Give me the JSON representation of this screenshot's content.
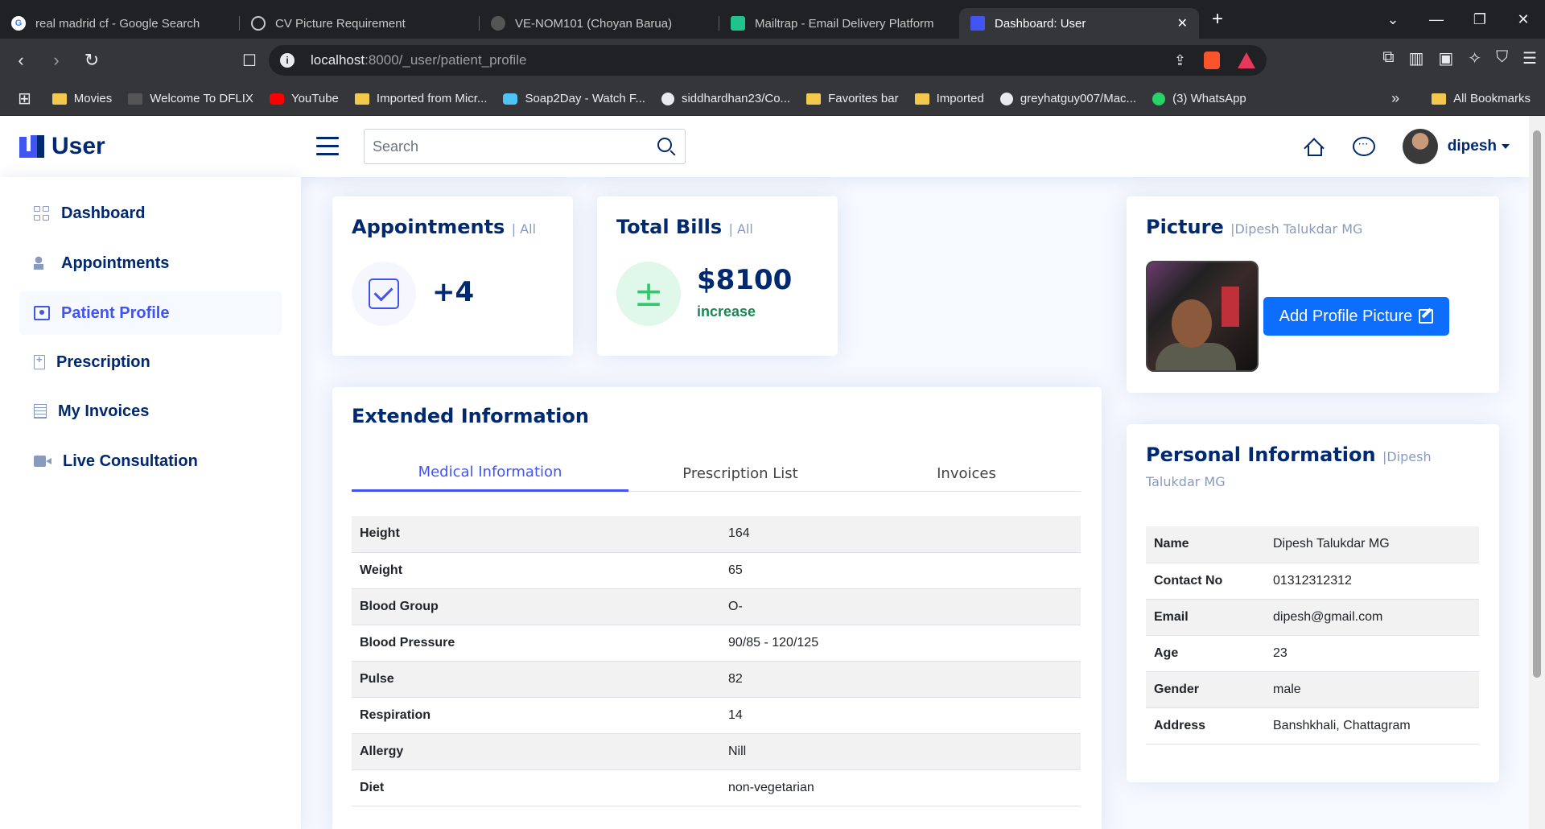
{
  "browser": {
    "tabs": [
      {
        "title": "real madrid cf - Google Search",
        "favicon": "google-icon"
      },
      {
        "title": "CV Picture Requirement",
        "favicon": "chatgpt-icon"
      },
      {
        "title": "VE-NOM101 (Choyan Barua)",
        "favicon": "github-icon"
      },
      {
        "title": "Mailtrap - Email Delivery Platform",
        "favicon": "mailtrap-icon"
      },
      {
        "title": "Dashboard: User",
        "favicon": "app-logo-icon",
        "active": true
      }
    ],
    "url_host": "localhost",
    "url_path": ":8000/_user/patient_profile",
    "bookmarks": [
      {
        "label": "Movies",
        "icon": "folder-icon"
      },
      {
        "label": "Welcome To DFLIX",
        "icon": "clapper-icon"
      },
      {
        "label": "YouTube",
        "icon": "youtube-icon"
      },
      {
        "label": "Imported from Micr...",
        "icon": "folder-icon"
      },
      {
        "label": "Soap2Day - Watch F...",
        "icon": "soap2day-icon"
      },
      {
        "label": "siddhardhan23/Co...",
        "icon": "github-icon"
      },
      {
        "label": "Favorites bar",
        "icon": "folder-icon"
      },
      {
        "label": "Imported",
        "icon": "folder-icon"
      },
      {
        "label": "greyhatguy007/Mac...",
        "icon": "github-icon"
      },
      {
        "label": "(3) WhatsApp",
        "icon": "whatsapp-icon"
      }
    ],
    "all_bookmarks": "All Bookmarks"
  },
  "header": {
    "logo_text": "User",
    "search_placeholder": "Search",
    "user_name": "dipesh"
  },
  "sidebar": {
    "items": [
      {
        "label": "Dashboard",
        "icon": "grid-icon"
      },
      {
        "label": "Appointments",
        "icon": "people-icon"
      },
      {
        "label": "Patient Profile",
        "icon": "person-card-icon",
        "active": true
      },
      {
        "label": "Prescription",
        "icon": "file-medical-icon"
      },
      {
        "label": "My Invoices",
        "icon": "receipt-icon"
      },
      {
        "label": "Live Consultation",
        "icon": "video-camera-icon"
      }
    ]
  },
  "appointments_card": {
    "title": "Appointments",
    "filter": "| All",
    "value": "+4"
  },
  "bills_card": {
    "title": "Total Bills",
    "filter": "| All",
    "value": "$8100",
    "trend": "increase"
  },
  "extended": {
    "title": "Extended Information",
    "tabs": [
      "Medical Information",
      "Prescription List",
      "Invoices"
    ],
    "rows": [
      {
        "label": "Height",
        "value": "164"
      },
      {
        "label": "Weight",
        "value": "65"
      },
      {
        "label": "Blood Group",
        "value": "O-"
      },
      {
        "label": "Blood Pressure",
        "value": "90/85 - 120/125"
      },
      {
        "label": "Pulse",
        "value": "82"
      },
      {
        "label": "Respiration",
        "value": "14"
      },
      {
        "label": "Allergy",
        "value": "Nill"
      },
      {
        "label": "Diet",
        "value": "non-vegetarian"
      }
    ]
  },
  "picture_card": {
    "title": "Picture",
    "subtitle": "|Dipesh Talukdar MG",
    "button": "Add Profile Picture"
  },
  "personal": {
    "title": "Personal Information",
    "subtitle": "|Dipesh Talukdar MG",
    "rows": [
      {
        "label": "Name",
        "value": "Dipesh Talukdar MG"
      },
      {
        "label": "Contact No",
        "value": "01312312312"
      },
      {
        "label": "Email",
        "value": "dipesh@gmail.com"
      },
      {
        "label": "Age",
        "value": "23"
      },
      {
        "label": "Gender",
        "value": "male"
      },
      {
        "label": "Address",
        "value": "Banshkhali, Chattagram"
      }
    ]
  },
  "colors": {
    "primary": "#4154f1",
    "navy": "#012970",
    "success": "#198754",
    "button": "#0d6efd"
  }
}
